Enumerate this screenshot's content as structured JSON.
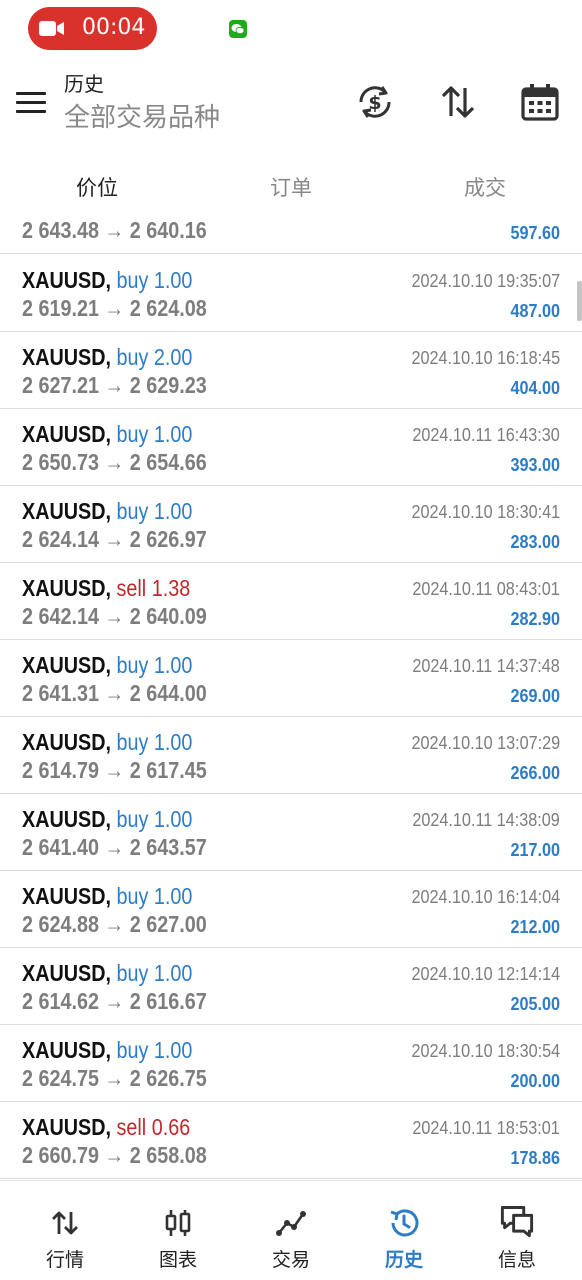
{
  "status_bar": {
    "recording_time": "00:04",
    "icons": [
      "video-camera-icon",
      "wechat-icon"
    ]
  },
  "app_bar": {
    "title": "历史",
    "subtitle": "全部交易品种",
    "icons": [
      "menu-icon",
      "dollar-refresh-icon",
      "sort-icon",
      "calendar-icon"
    ]
  },
  "tabs": [
    {
      "label": "价位",
      "active": true
    },
    {
      "label": "订单",
      "active": false
    },
    {
      "label": "成交",
      "active": false
    }
  ],
  "partial_row": {
    "prices": "2 643.48 → 2 640.16",
    "profit": "597.60"
  },
  "deals": [
    {
      "symbol": "XAUUSD,",
      "side": "buy",
      "volume": "buy 1.00",
      "prices": "2 619.21 → 2 624.08",
      "time": "2024.10.10 19:35:07",
      "profit": "487.00"
    },
    {
      "symbol": "XAUUSD,",
      "side": "buy",
      "volume": "buy 2.00",
      "prices": "2 627.21 → 2 629.23",
      "time": "2024.10.10 16:18:45",
      "profit": "404.00"
    },
    {
      "symbol": "XAUUSD,",
      "side": "buy",
      "volume": "buy 1.00",
      "prices": "2 650.73 → 2 654.66",
      "time": "2024.10.11 16:43:30",
      "profit": "393.00"
    },
    {
      "symbol": "XAUUSD,",
      "side": "buy",
      "volume": "buy 1.00",
      "prices": "2 624.14 → 2 626.97",
      "time": "2024.10.10 18:30:41",
      "profit": "283.00"
    },
    {
      "symbol": "XAUUSD,",
      "side": "sell",
      "volume": "sell 1.38",
      "prices": "2 642.14 → 2 640.09",
      "time": "2024.10.11 08:43:01",
      "profit": "282.90"
    },
    {
      "symbol": "XAUUSD,",
      "side": "buy",
      "volume": "buy 1.00",
      "prices": "2 641.31 → 2 644.00",
      "time": "2024.10.11 14:37:48",
      "profit": "269.00"
    },
    {
      "symbol": "XAUUSD,",
      "side": "buy",
      "volume": "buy 1.00",
      "prices": "2 614.79 → 2 617.45",
      "time": "2024.10.10 13:07:29",
      "profit": "266.00"
    },
    {
      "symbol": "XAUUSD,",
      "side": "buy",
      "volume": "buy 1.00",
      "prices": "2 641.40 → 2 643.57",
      "time": "2024.10.11 14:38:09",
      "profit": "217.00"
    },
    {
      "symbol": "XAUUSD,",
      "side": "buy",
      "volume": "buy 1.00",
      "prices": "2 624.88 → 2 627.00",
      "time": "2024.10.10 16:14:04",
      "profit": "212.00"
    },
    {
      "symbol": "XAUUSD,",
      "side": "buy",
      "volume": "buy 1.00",
      "prices": "2 614.62 → 2 616.67",
      "time": "2024.10.10 12:14:14",
      "profit": "205.00"
    },
    {
      "symbol": "XAUUSD,",
      "side": "buy",
      "volume": "buy 1.00",
      "prices": "2 624.75 → 2 626.75",
      "time": "2024.10.10 18:30:54",
      "profit": "200.00"
    },
    {
      "symbol": "XAUUSD,",
      "side": "sell",
      "volume": "sell 0.66",
      "prices": "2 660.79 → 2 658.08",
      "time": "2024.10.11 18:53:01",
      "profit": "178.86"
    }
  ],
  "bottom_nav": [
    {
      "label": "行情",
      "icon": "quotes-icon",
      "active": false
    },
    {
      "label": "图表",
      "icon": "chart-icon",
      "active": false
    },
    {
      "label": "交易",
      "icon": "trade-icon",
      "active": false
    },
    {
      "label": "历史",
      "icon": "history-icon",
      "active": true
    },
    {
      "label": "信息",
      "icon": "messages-icon",
      "active": false
    }
  ],
  "colors": {
    "accent": "#2f7cc6",
    "sell": "#c1272d",
    "recording": "#d9312b",
    "muted": "#7d7d7d"
  }
}
